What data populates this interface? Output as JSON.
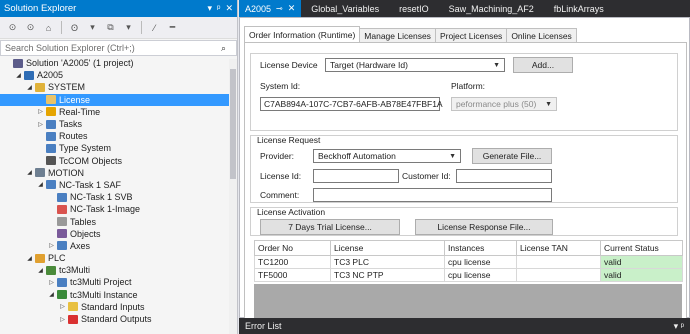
{
  "solution_explorer": {
    "title": "Solution Explorer",
    "title_controls": [
      "▾",
      "ᵖ",
      "✕"
    ],
    "toolbar": [
      "⊙",
      "⊙",
      "⌂",
      "ʘ",
      "▾",
      "⧉",
      "▾",
      "⁄",
      "━"
    ],
    "search_placeholder": "Search Solution Explorer (Ctrl+;)",
    "search_icon": "⌕",
    "tree": [
      {
        "label": "Solution 'A2005' (1 project)",
        "indent": 0,
        "exp": "",
        "icon": "solution-icon",
        "color": "#5c5c8a"
      },
      {
        "label": "A2005",
        "indent": 1,
        "exp": "◢",
        "icon": "project-icon",
        "color": "#2f6db5"
      },
      {
        "label": "SYSTEM",
        "indent": 2,
        "exp": "◢",
        "icon": "system-icon",
        "color": "#e0b23a"
      },
      {
        "label": "License",
        "indent": 3,
        "exp": "",
        "icon": "license-icon",
        "color": "#e8c36a",
        "selected": true
      },
      {
        "label": "Real-Time",
        "indent": 3,
        "exp": "▷",
        "icon": "realtime-icon",
        "color": "#e5a400"
      },
      {
        "label": "Tasks",
        "indent": 3,
        "exp": "▷",
        "icon": "tasks-icon",
        "color": "#4a7fc1"
      },
      {
        "label": "Routes",
        "indent": 3,
        "exp": "",
        "icon": "routes-icon",
        "color": "#4a7fc1"
      },
      {
        "label": "Type System",
        "indent": 3,
        "exp": "",
        "icon": "type-system-icon",
        "color": "#4a7fc1"
      },
      {
        "label": "TcCOM Objects",
        "indent": 3,
        "exp": "",
        "icon": "tccom-icon",
        "color": "#555"
      },
      {
        "label": "MOTION",
        "indent": 2,
        "exp": "◢",
        "icon": "motion-icon",
        "color": "#6e7f91"
      },
      {
        "label": "NC-Task 1 SAF",
        "indent": 3,
        "exp": "◢",
        "icon": "nc-task-icon",
        "color": "#4a7fc1"
      },
      {
        "label": "NC-Task 1 SVB",
        "indent": 4,
        "exp": "",
        "icon": "nc-svb-icon",
        "color": "#4a7fc1"
      },
      {
        "label": "NC-Task 1-Image",
        "indent": 4,
        "exp": "",
        "icon": "nc-image-icon",
        "color": "#d9534f"
      },
      {
        "label": "Tables",
        "indent": 4,
        "exp": "",
        "icon": "tables-icon",
        "color": "#999"
      },
      {
        "label": "Objects",
        "indent": 4,
        "exp": "",
        "icon": "objects-icon",
        "color": "#7a5a9a"
      },
      {
        "label": "Axes",
        "indent": 4,
        "exp": "▷",
        "icon": "axes-icon",
        "color": "#4a7fc1"
      },
      {
        "label": "PLC",
        "indent": 2,
        "exp": "◢",
        "icon": "plc-icon",
        "color": "#e0a030"
      },
      {
        "label": "tc3Multi",
        "indent": 3,
        "exp": "◢",
        "icon": "plc-project-icon",
        "color": "#4a8a3a"
      },
      {
        "label": "tc3Multi Project",
        "indent": 4,
        "exp": "▷",
        "icon": "plc-subproject-icon",
        "color": "#4a7fc1"
      },
      {
        "label": "tc3Multi Instance",
        "indent": 4,
        "exp": "◢",
        "icon": "plc-instance-icon",
        "color": "#3a8a3a"
      },
      {
        "label": "Standard Inputs",
        "indent": 5,
        "exp": "▷",
        "icon": "inputs-icon",
        "color": "#e8c040"
      },
      {
        "label": "Standard Outputs",
        "indent": 5,
        "exp": "▷",
        "icon": "outputs-icon",
        "color": "#d93030"
      }
    ]
  },
  "doc_tabs": [
    {
      "label": "A2005",
      "pin": "⊸",
      "close": "✕",
      "active": true
    },
    {
      "label": "Global_Variables"
    },
    {
      "label": "resetIO"
    },
    {
      "label": "Saw_Machining_AF2"
    },
    {
      "label": "fbLinkArrays"
    }
  ],
  "inner_tabs": [
    "Order Information (Runtime)",
    "Manage Licenses",
    "Project Licenses",
    "Online Licenses"
  ],
  "license_device": {
    "label": "License Device",
    "value": "Target (Hardware Id)",
    "add_button": "Add...",
    "system_id_label": "System Id:",
    "system_id_value": "C7AB894A-107C-7CB7-6AFB-AB78E47FBF1A",
    "platform_label": "Platform:",
    "platform_value": "peformance plus (50)"
  },
  "license_request": {
    "title": "License Request",
    "provider_label": "Provider:",
    "provider_value": "Beckhoff Automation",
    "generate_button": "Generate File...",
    "license_id_label": "License Id:",
    "customer_id_label": "Customer Id:",
    "comment_label": "Comment:"
  },
  "license_activation": {
    "title": "License Activation",
    "trial_button": "7 Days Trial License...",
    "response_button": "License Response File..."
  },
  "grid": {
    "headers": [
      "Order No",
      "License",
      "Instances",
      "License TAN",
      "Current Status"
    ],
    "rows": [
      [
        "TC1200",
        "TC3 PLC",
        "cpu license",
        "",
        "valid"
      ],
      [
        "TF5000",
        "TC3 NC PTP",
        "cpu license",
        "",
        "valid"
      ]
    ]
  },
  "error_list": {
    "title": "Error List",
    "controls": "▾ ᵖ"
  }
}
